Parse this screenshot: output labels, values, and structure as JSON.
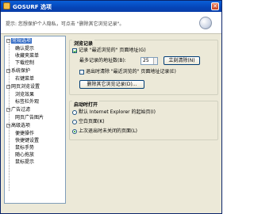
{
  "window": {
    "title": "GOSURF 选项",
    "close_glyph": "✕"
  },
  "hint": {
    "text": "提示: 您想保护个人隐私，可点击 \"删除其它浏览记录\"。"
  },
  "tree": {
    "items": [
      {
        "label": "常规选项",
        "level": 0,
        "expanded": true,
        "selected": true
      },
      {
        "label": "确认提示",
        "level": 1
      },
      {
        "label": "收藏夹菜单",
        "level": 1
      },
      {
        "label": "下载控制",
        "level": 1
      },
      {
        "label": "系统保护",
        "level": 0,
        "expanded": true
      },
      {
        "label": "右键菜单",
        "level": 1
      },
      {
        "label": "网页浏览设置",
        "level": 0,
        "expanded": true
      },
      {
        "label": "浏览效果",
        "level": 1
      },
      {
        "label": "标签栏外观",
        "level": 1
      },
      {
        "label": "广告过滤",
        "level": 0,
        "expanded": true
      },
      {
        "label": "网页广告图片",
        "level": 1
      },
      {
        "label": "高级选项",
        "level": 0,
        "expanded": true
      },
      {
        "label": "便捷操作",
        "level": 1
      },
      {
        "label": "快捷键设置",
        "level": 1
      },
      {
        "label": "鼠标手势",
        "level": 1
      },
      {
        "label": "随心拖放",
        "level": 1
      },
      {
        "label": "鼠标提示",
        "level": 1
      }
    ]
  },
  "history": {
    "title": "浏览记录",
    "record_label": "记录 \"最近浏览的\" 页面地址(G)",
    "record_checked": true,
    "max_label": "最多记录的地址数(B):",
    "max_value": "25",
    "clear_now_button": "立刻清除(N)",
    "clear_on_exit_label": "退出时清除 \"最近浏览的\" 页面地址记录(E)",
    "clear_on_exit_checked": false,
    "delete_other_button": "删除其它浏览记录(D)..."
  },
  "startup": {
    "title": "启动时打开",
    "options": [
      {
        "label": "默认 Internet Explorer 的起始页(I)",
        "checked": false
      },
      {
        "label": "空白页面(K)",
        "checked": false
      },
      {
        "label": "上次退出时未关闭的页面(L)",
        "checked": true
      }
    ]
  },
  "colors": {
    "title_bar": "#0545b8",
    "selection": "#316ac5",
    "dialog_bg": "#ece9d8"
  }
}
